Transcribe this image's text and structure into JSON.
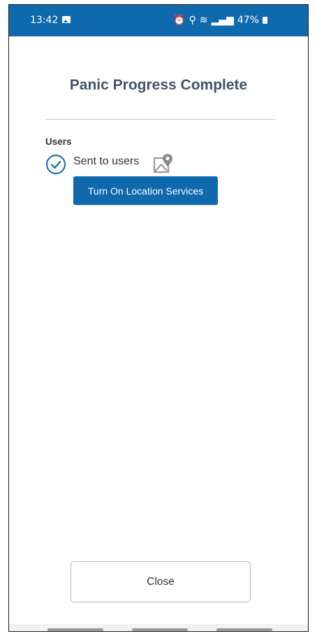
{
  "status_bar": {
    "time": "13:42",
    "battery_percent": "47%",
    "icons": [
      "gallery-icon",
      "alarm-icon",
      "location-icon",
      "wifi-icon",
      "signal-icon",
      "battery-icon"
    ],
    "background": "#0f69ad"
  },
  "dialog": {
    "title": "Panic Progress Complete",
    "section_label": "Users",
    "sent_status": "Sent to users",
    "location_button_label": "Turn On Location Services",
    "close_button_label": "Close"
  },
  "colors": {
    "accent": "#0f69ad",
    "title_text": "#44546a"
  }
}
